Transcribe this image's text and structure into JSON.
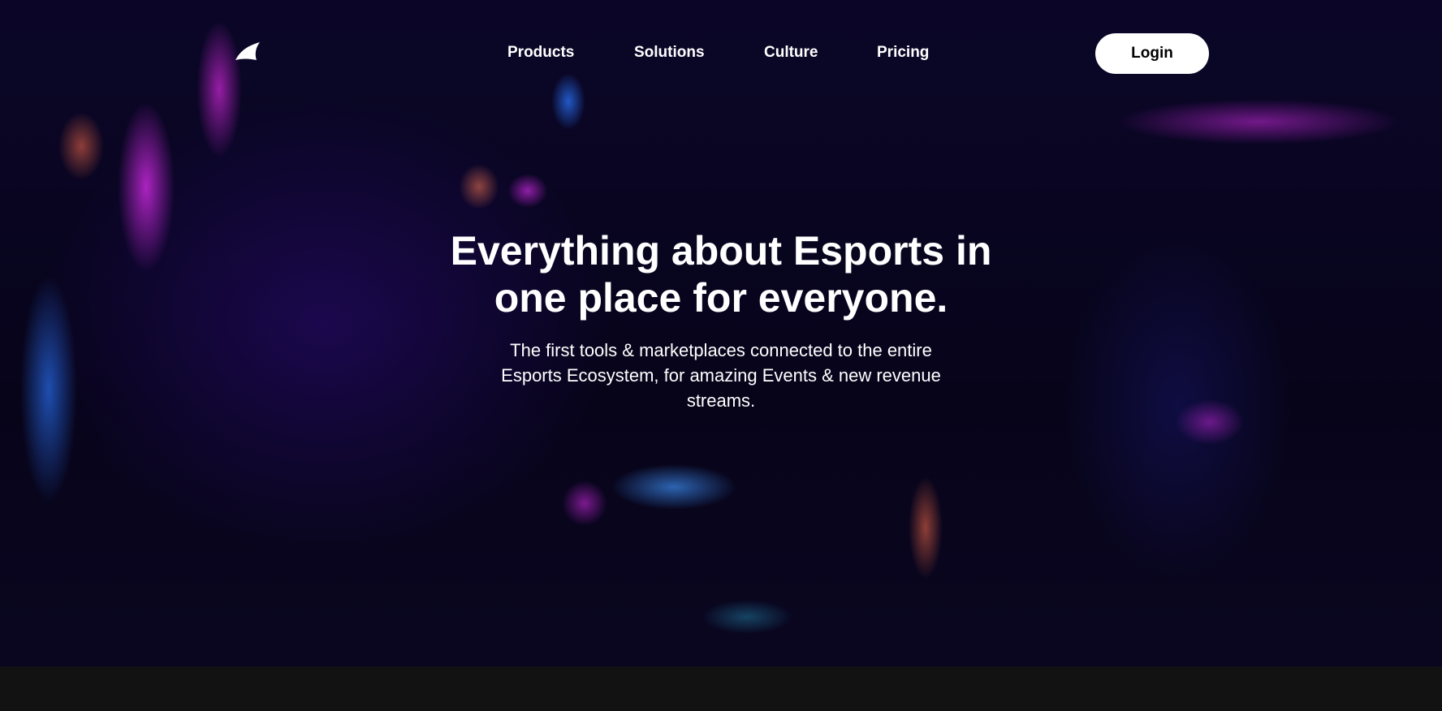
{
  "nav": {
    "items": [
      {
        "label": "Products"
      },
      {
        "label": "Solutions"
      },
      {
        "label": "Culture"
      },
      {
        "label": "Pricing"
      }
    ],
    "login_label": "Login"
  },
  "hero": {
    "title_line1": "Everything about Esports in",
    "title_line2": "one place for everyone.",
    "subtitle": "The first tools & marketplaces connected to the entire Esports Ecosystem, for amazing Events & new revenue streams."
  },
  "colors": {
    "background": "#0b0628",
    "footer_band": "#121212",
    "accent_magenta": "#c828dc",
    "accent_blue": "#286ef0"
  }
}
